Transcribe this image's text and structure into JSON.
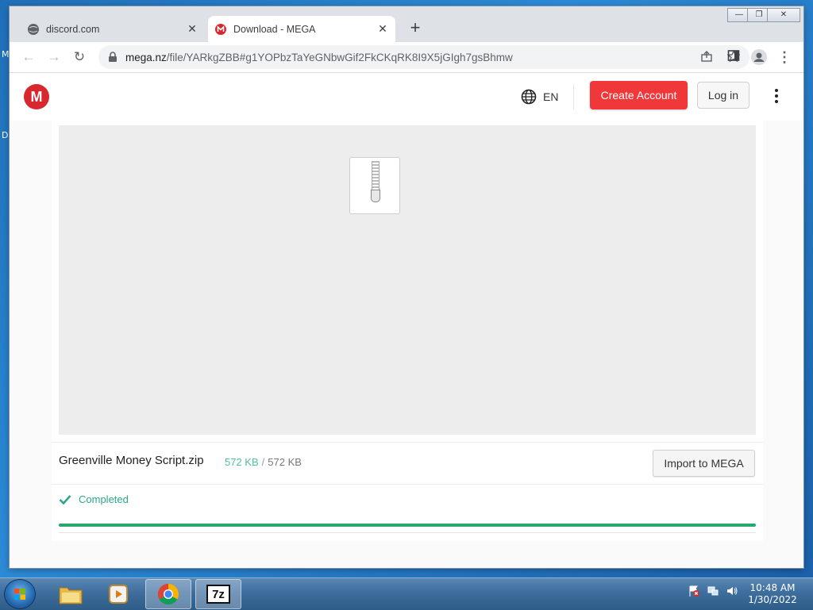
{
  "desktop": {
    "left_fragments": [
      "M",
      "D"
    ]
  },
  "browser": {
    "tabs": [
      {
        "title": "discord.com",
        "close": "✕"
      },
      {
        "title": "Download - MEGA",
        "close": "✕"
      }
    ],
    "new_tab": "+",
    "window_controls": [
      "—",
      "❐",
      "✕"
    ],
    "url_host": "mega.nz",
    "url_path": "/file/YARkgZBB#g1YOPbzTaYeGNbwGif2FkCKqRK8I9X5jGIgh7gsBhmw"
  },
  "mega": {
    "logo": "M",
    "language": "EN",
    "create_account": "Create Account",
    "login": "Log in",
    "file": {
      "name": "Greenville Money Script.zip",
      "downloaded": "572 KB",
      "separator": "/",
      "total": "572 KB",
      "import_label": "Import to MEGA"
    },
    "status": "Completed",
    "progress_fraction": 1.0,
    "colors": {
      "brand_red": "#d9272e",
      "create_button": "#f0373a",
      "progress": "#28a76e",
      "status_text": "#2ba88a"
    }
  },
  "taskbar": {
    "apps": [
      "file-explorer",
      "media-player",
      "chrome",
      "7-zip"
    ],
    "seven_zip_label": "7z",
    "time": "10:48 AM",
    "date": "1/30/2022"
  }
}
